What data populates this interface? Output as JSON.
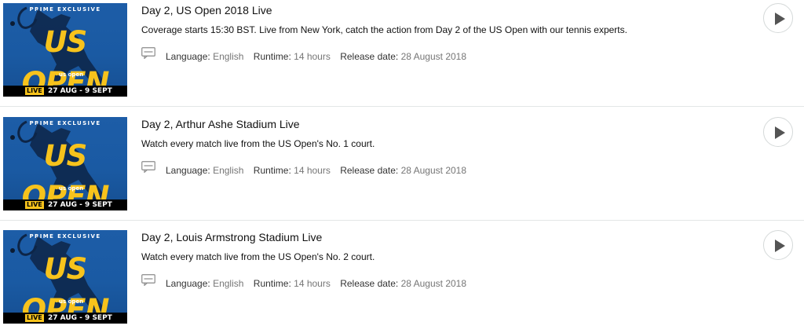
{
  "colors": {
    "thumb_blue": "#1d5da7",
    "thumb_yellow": "#f7c31c",
    "meta_value": "#767676",
    "divider": "#e3e6e6"
  },
  "episodes": [
    {
      "thumb": {
        "badge": "PRIME EXCLUSIVE",
        "title": "US OPEN",
        "logo": "us open",
        "live": "LIVE",
        "dates": "27 AUG - 9 SEPT"
      },
      "title": "Day 2, US Open 2018 Live",
      "synopsis": "Coverage starts 15:30 BST. Live from New York, catch the action from Day 2 of the US Open with our tennis experts.",
      "subtitles_icon": "speech-bubble-icon",
      "language_label": "Language:",
      "language": "English",
      "runtime_label": "Runtime:",
      "runtime": "14 hours",
      "release_label": "Release date:",
      "release_date": "28 August 2018",
      "play_icon": "play-icon"
    },
    {
      "thumb": {
        "badge": "PRIME EXCLUSIVE",
        "title": "US OPEN",
        "logo": "us open",
        "live": "LIVE",
        "dates": "27 AUG - 9 SEPT"
      },
      "title": "Day 2, Arthur Ashe Stadium Live",
      "synopsis": "Watch every match live from the US Open's No. 1 court.",
      "subtitles_icon": "speech-bubble-icon",
      "language_label": "Language:",
      "language": "English",
      "runtime_label": "Runtime:",
      "runtime": "14 hours",
      "release_label": "Release date:",
      "release_date": "28 August 2018",
      "play_icon": "play-icon"
    },
    {
      "thumb": {
        "badge": "PRIME EXCLUSIVE",
        "title": "US OPEN",
        "logo": "us open",
        "live": "LIVE",
        "dates": "27 AUG - 9 SEPT"
      },
      "title": "Day 2, Louis Armstrong Stadium Live",
      "synopsis": "Watch every match live from the US Open's No. 2 court.",
      "subtitles_icon": "speech-bubble-icon",
      "language_label": "Language:",
      "language": "English",
      "runtime_label": "Runtime:",
      "runtime": "14 hours",
      "release_label": "Release date:",
      "release_date": "28 August 2018",
      "play_icon": "play-icon"
    }
  ]
}
